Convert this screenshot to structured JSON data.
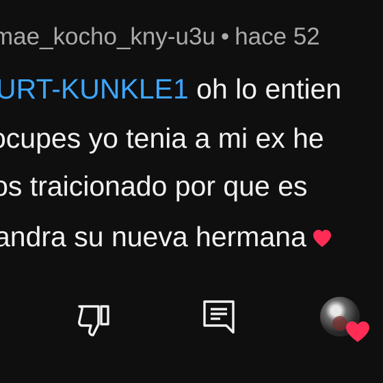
{
  "comment": {
    "author": "mae_kocho_kny-u3u",
    "separator": "•",
    "time": "hace 52",
    "mention": "URT-KUNKLE1",
    "lines": [
      " oh lo entien",
      "ocupes yo tenia a mi ex he",
      "los traicionado por que es",
      "andra su nueva hermana"
    ],
    "inline_emoji": "heart-icon"
  },
  "actions": {
    "dislike_icon": "thumbs-down-icon",
    "reply_icon": "comment-reply-icon",
    "creator_heart_icon": "heart-icon"
  },
  "colors": {
    "background": "#0f0f0f",
    "text": "#f1f1f1",
    "meta": "#aaaaaa",
    "mention": "#3ea6ff",
    "heart": "#ff2d55"
  }
}
